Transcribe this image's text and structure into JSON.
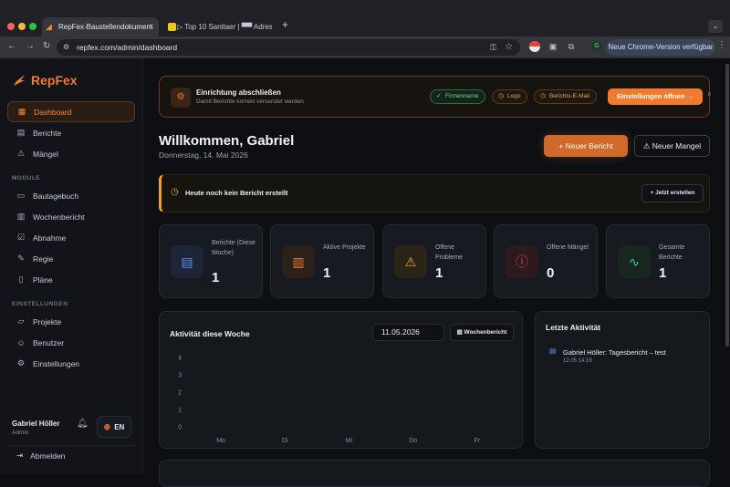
{
  "browser": {
    "tabs": [
      {
        "title": "RepFex-Baustellendokument"
      },
      {
        "title": "▷ Top 10 Sanitaer | ▀▀ Adres"
      }
    ],
    "url": "repfex.com/admin/dashboard",
    "update_label": "Neue Chrome-Version verfügbar",
    "profile_initial": "G"
  },
  "sidebar": {
    "logo": "RepFex",
    "items": [
      {
        "label": "Dashboard",
        "icon": "dashboard-icon"
      },
      {
        "label": "Berichte",
        "icon": "document-icon"
      },
      {
        "label": "Mängel",
        "icon": "warning-icon"
      }
    ],
    "module_label": "MODULE",
    "modules": [
      {
        "label": "Bautagebuch",
        "icon": "book-icon"
      },
      {
        "label": "Wochenbericht",
        "icon": "bar-chart-icon"
      },
      {
        "label": "Abnahme",
        "icon": "clipboard-check-icon"
      },
      {
        "label": "Regie",
        "icon": "wrench-icon"
      },
      {
        "label": "Pläne",
        "icon": "file-icon"
      }
    ],
    "settings_label": "EINSTELLUNGEN",
    "settings": [
      {
        "label": "Projekte",
        "icon": "folder-icon"
      },
      {
        "label": "Benutzer",
        "icon": "users-icon"
      },
      {
        "label": "Einstellungen",
        "icon": "gear-icon"
      }
    ],
    "user": {
      "name": "Gabriel Höller",
      "role": "Admin"
    },
    "language": "EN",
    "logout": "Abmelden"
  },
  "setup": {
    "title": "Einrichtung abschließen",
    "subtitle": "Damit Berichte korrekt versendet werden",
    "chips": [
      {
        "label": "Firmenname",
        "state": "done"
      },
      {
        "label": "Logo",
        "state": "open"
      },
      {
        "label": "Berichts-E-Mail",
        "state": "open"
      }
    ],
    "button": "Einstellungen öffnen →",
    "close": "×"
  },
  "header": {
    "welcome": "Willkommen, Gabriel",
    "date": "Donnerstag, 14. Mai 2026",
    "new_report": "+ Neuer Bericht",
    "new_defect": "Neuer Mangel"
  },
  "notice": {
    "text": "Heute noch kein Bericht erstellt",
    "button": "+ Jetzt erstellen"
  },
  "stats": [
    {
      "label": "Berichte (Diese Woche)",
      "value": "1",
      "icon": "document-icon",
      "color": "#5b8dea",
      "bg": "#1d2638"
    },
    {
      "label": "Aktive Projekte",
      "value": "1",
      "icon": "folder-icon",
      "color": "#f27a2e",
      "bg": "#2c2119"
    },
    {
      "label": "Offene Probleme",
      "value": "1",
      "icon": "warning-icon",
      "color": "#f0a030",
      "bg": "#2c2417"
    },
    {
      "label": "Offene Mängel",
      "value": "0",
      "icon": "alert-circle-icon",
      "color": "#e5484d",
      "bg": "#2c1a1c"
    },
    {
      "label": "Gesamte Berichte",
      "value": "1",
      "icon": "activity-icon",
      "color": "#3fcf8e",
      "bg": "#17261f"
    }
  ],
  "activity": {
    "title": "Aktivität diese Woche",
    "date_value": "11.05.2026",
    "week_button": "Wochenbericht"
  },
  "chart_data": {
    "type": "bar",
    "categories": [
      "Mo",
      "Di",
      "Mi",
      "Do",
      "Fr"
    ],
    "values": [
      0,
      0,
      0,
      0,
      0
    ],
    "yticks": [
      0,
      1,
      2,
      3,
      4
    ],
    "ylim": [
      0,
      4
    ],
    "title": "",
    "xlabel": "",
    "ylabel": "",
    "grid": false
  },
  "recent": {
    "title": "Letzte Aktivität",
    "items": [
      {
        "title": "Gabriel Höller: Tagesbericht – test",
        "time": "12.05 14:19"
      }
    ]
  }
}
